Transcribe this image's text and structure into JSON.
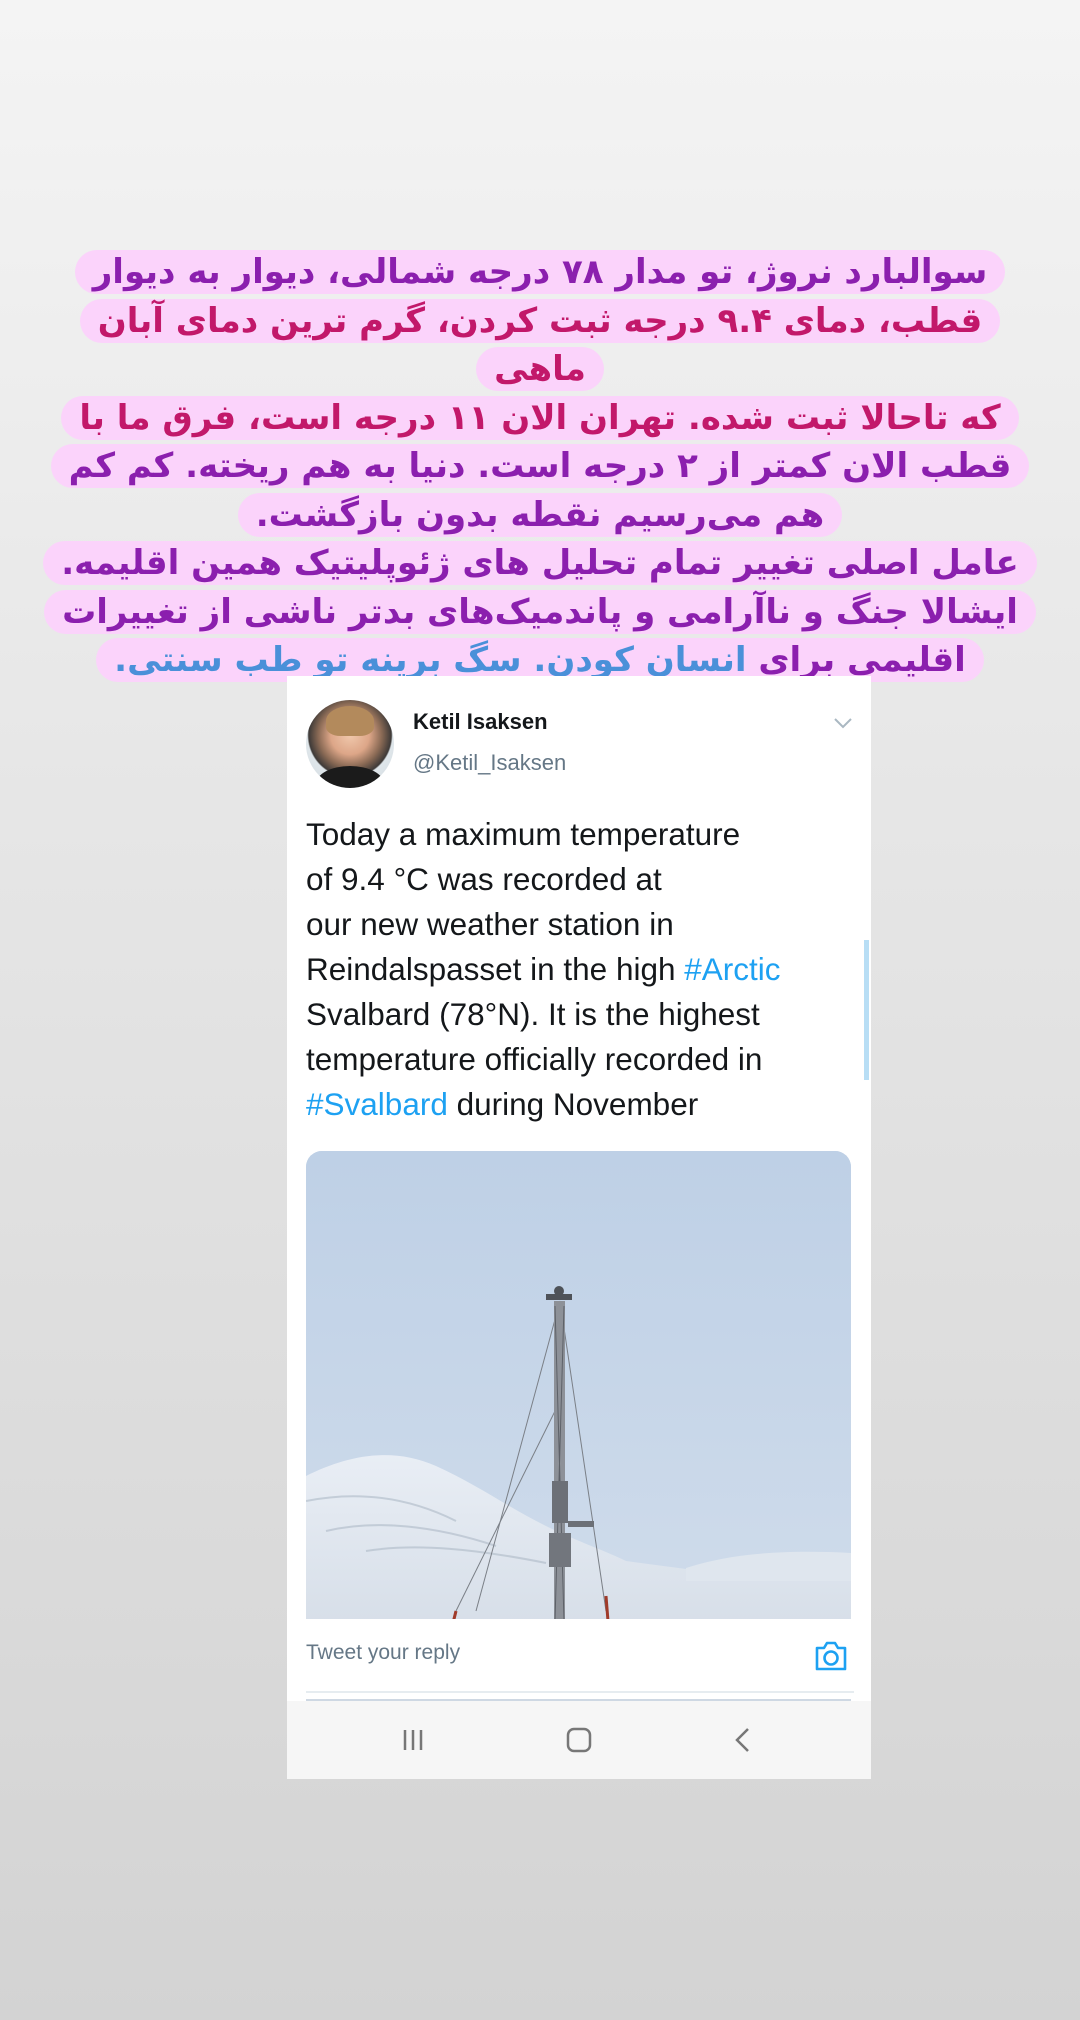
{
  "caption": {
    "lines": [
      "سوالبارد نروژ، تو مدار ۷۸ درجه شمالی، دیوار به دیوار",
      "قطب، دمای ۹.۴ درجه ثبت کردن، گرم ترین دمای آبان ماهی",
      "که تاحالا ثبت شده. تهران الان ۱۱ درجه است، فرق ما با",
      "قطب الان کمتر از ۲ درجه است. دنیا به هم ریخته. کم کم",
      "هم می‌رسیم نقطه بدون بازگشت."
    ],
    "line6": "عامل اصلی تغییر تمام تحلیل های ژئوپلیتیک همین اقلیمه.",
    "line7": "ایشالا جنگ و ناآرامی و پاندمیک‌های بدتر ناشی از تغییرات",
    "line8_a": "اقلیمی برای",
    "line8_b": "انسان کودن.",
    "line8_c": "سگ برینه تو طب سنتی."
  },
  "tweet": {
    "author_name": "Ketil Isaksen",
    "author_handle": "@Ketil_Isaksen",
    "line1": "Today a maximum temperature",
    "line2": "of 9.4 °C was recorded at",
    "line3": "our new weather station in",
    "line4_a": "Reindalspasset in the high ",
    "line4_tag": "#Arctic",
    "line5": "Svalbard (78°N). It is the highest",
    "line6": "temperature officially recorded in",
    "line7_tag": "#Svalbard",
    "line7_b": " during November"
  },
  "reply": {
    "placeholder": "Tweet your reply"
  },
  "icons": {
    "chevron": "chevron-down-icon",
    "camera": "camera-icon",
    "recents": "recent-apps-icon",
    "home": "home-icon",
    "back": "back-icon"
  },
  "colors": {
    "caption_highlight": "#fbd3fb",
    "caption_purple": "#8b1fae",
    "caption_crimson": "#c2186a",
    "caption_blue": "#4a90d9",
    "twitter_blue": "#1da1f2"
  }
}
